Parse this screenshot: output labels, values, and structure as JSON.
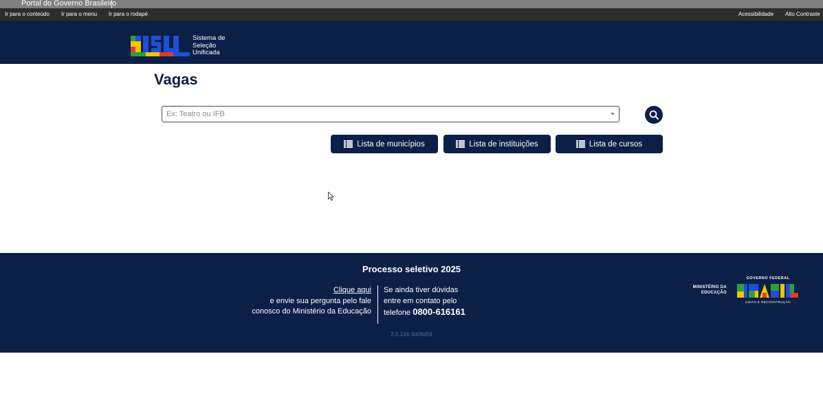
{
  "govbar": {
    "label": "Portal do Governo Brasileiro"
  },
  "accessibility_bar": {
    "skip_content": "Ir para o conteúdo",
    "skip_menu": "Ir para o menu",
    "skip_footer": "Ir para o rodapé",
    "accessibility": "Acessibilidade",
    "high_contrast": "Alto Contraste"
  },
  "header": {
    "logo_text": "SISU",
    "logo_line1": "Sistema de",
    "logo_line2": "Seleção",
    "logo_line3": "Unificada"
  },
  "main": {
    "title": "Vagas",
    "search_placeholder": "Ex: Teatro ou IFB",
    "search_value": "",
    "buttons": {
      "municipios": "Lista de municípios",
      "instituicoes": "Lista de instituições",
      "cursos": "Lista de cursos"
    }
  },
  "footer": {
    "title": "Processo seletivo 2025",
    "left_link": "Clique aqui",
    "left_line2": "e envie sua pergunta pelo fale",
    "left_line3": "conosco do Ministério da Educação",
    "right_line1": "Se ainda tiver dúvidas",
    "right_line2": "entre em contato pelo",
    "right_line3_prefix": "telefone",
    "phone": "0800-616161",
    "version": "2.0.134-3d08d59",
    "mec_line1": "MINISTÉRIO DA",
    "mec_line2": "EDUCAÇÃO",
    "gov_federal": "GOVERNO FEDERAL",
    "brasil": "BRASIL",
    "uniao": "UNIÃO E RECONSTRUÇÃO"
  },
  "colors": {
    "navy": "#0c1f46",
    "govbar_gray": "#808080",
    "accbar_dark": "#2d2d2d"
  },
  "icons": [
    "search-icon",
    "list-icon",
    "chevron-down-icon",
    "cursor-icon"
  ]
}
